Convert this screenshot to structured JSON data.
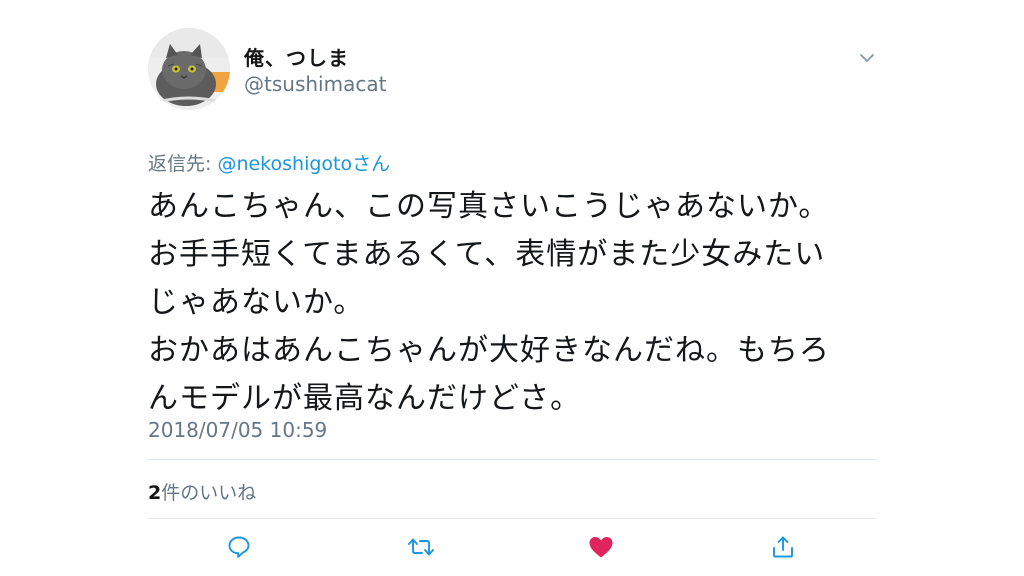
{
  "user": {
    "display_name": "俺、つしま",
    "handle": "@tsushimacat"
  },
  "reply": {
    "prefix": "返信先: ",
    "mention": "@nekoshigotoさん"
  },
  "tweet": {
    "lines": [
      "あんこちゃん、この写真さいこうじゃあないか。",
      "お手手短くてまあるくて、表情がまた少女みたい",
      "じゃあないか。",
      "おかあはあんこちゃんが大好きなんだね。もちろ",
      "んモデルが最高なんだけどさ。"
    ],
    "timestamp": "2018/07/05 10:59"
  },
  "likes": {
    "count": "2",
    "label": "件のいいね"
  },
  "actions": {
    "reply_icon": "comment-icon",
    "retweet_icon": "retweet-icon",
    "like_icon": "heart-icon",
    "share_icon": "share-icon"
  },
  "colors": {
    "text": "#14171a",
    "secondary": "#657786",
    "link": "#1b95e0",
    "like": "#e0245e",
    "divider": "#e1e8ed"
  }
}
